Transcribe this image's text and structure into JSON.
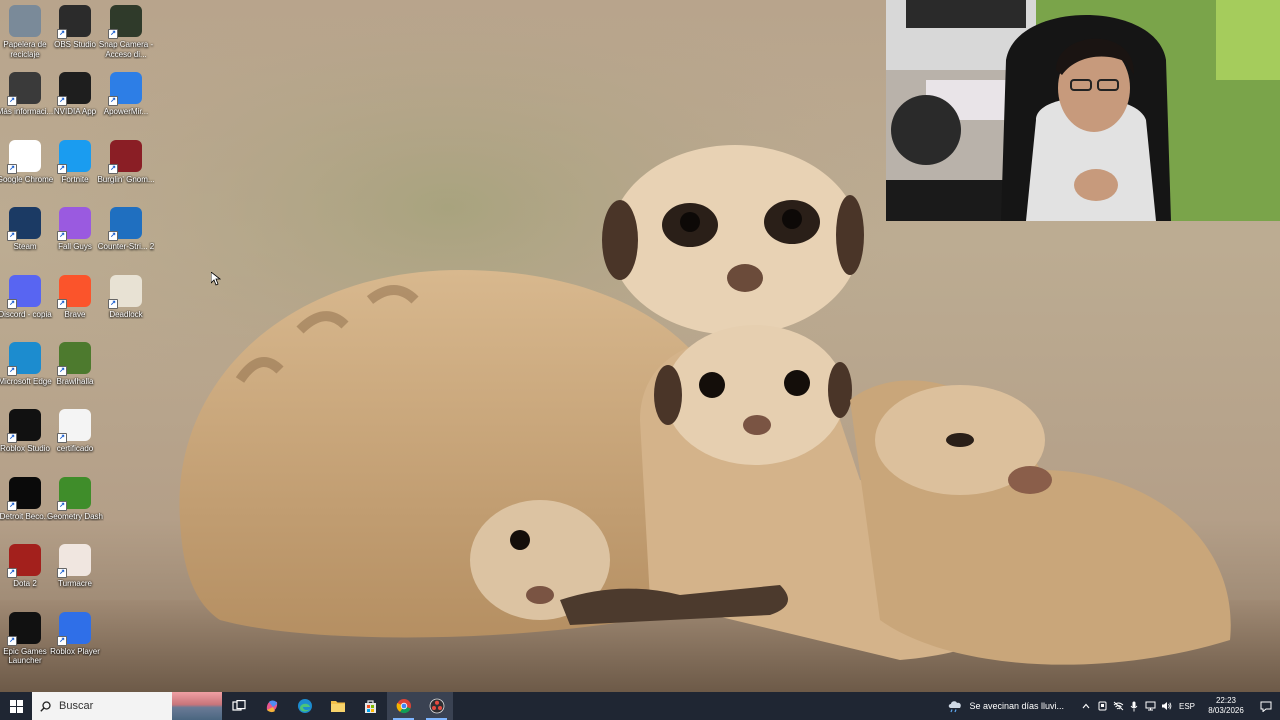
{
  "desktop": {
    "icons": [
      {
        "label": "Papelera de reciclaje",
        "icon": "recycle-bin-icon",
        "color": "#7a8a99"
      },
      {
        "label": "OBS Studio",
        "icon": "obs-icon",
        "color": "#2b2b2b"
      },
      {
        "label": "Snap Camera - Acceso di...",
        "icon": "snap-camera-icon",
        "color": "#2f3a2a"
      },
      {
        "label": "Más informaci...",
        "icon": "info-icon",
        "color": "#3a3a3a"
      },
      {
        "label": "NVIDIA App",
        "icon": "nvidia-icon",
        "color": "#1e1e1e"
      },
      {
        "label": "ApowerMir...",
        "icon": "apowermirror-icon",
        "color": "#2d7ee6"
      },
      {
        "label": "Google Chrome",
        "icon": "chrome-icon",
        "color": "#ffffff"
      },
      {
        "label": "Fortnite",
        "icon": "fortnite-icon",
        "color": "#1a9cf0"
      },
      {
        "label": "Burglin' Gnom...",
        "icon": "burglin-gnomes-icon",
        "color": "#8a1e25"
      },
      {
        "label": "Steam",
        "icon": "steam-icon",
        "color": "#1b3a64"
      },
      {
        "label": "Fall Guys",
        "icon": "fall-guys-icon",
        "color": "#9a5ae0"
      },
      {
        "label": "Counter-Stri... 2",
        "icon": "counter-strike-icon",
        "color": "#1f6fc0"
      },
      {
        "label": "Discord - copia",
        "icon": "discord-icon",
        "color": "#5865f2"
      },
      {
        "label": "Brave",
        "icon": "brave-icon",
        "color": "#fb542b"
      },
      {
        "label": "Deadlock",
        "icon": "deadlock-icon",
        "color": "#e8e2d4"
      },
      {
        "label": "Microsoft Edge",
        "icon": "edge-icon",
        "color": "#1c8ccf"
      },
      {
        "label": "Brawlhalla",
        "icon": "brawlhalla-icon",
        "color": "#4d7a2e"
      },
      {
        "label": "Roblox Studio",
        "icon": "roblox-studio-icon",
        "color": "#111111"
      },
      {
        "label": "certificado",
        "icon": "document-icon",
        "color": "#f4f4f4"
      },
      {
        "label": "Detroit Beco...",
        "icon": "detroit-icon",
        "color": "#0a0a0a"
      },
      {
        "label": "Geometry Dash",
        "icon": "geometry-dash-icon",
        "color": "#3f8d2a"
      },
      {
        "label": "Dota 2",
        "icon": "dota2-icon",
        "color": "#a3201c"
      },
      {
        "label": "Turmacre",
        "icon": "turmacre-icon",
        "color": "#f0e6e0"
      },
      {
        "label": "Epic Games Launcher",
        "icon": "epic-games-icon",
        "color": "#111111"
      },
      {
        "label": "Roblox Player",
        "icon": "roblox-icon",
        "color": "#2f6fe8"
      }
    ]
  },
  "taskbar": {
    "search_placeholder": "Buscar",
    "apps": [
      {
        "name": "task-view-icon",
        "active": false
      },
      {
        "name": "copilot-icon",
        "active": false
      },
      {
        "name": "edge-icon",
        "active": false
      },
      {
        "name": "file-explorer-icon",
        "active": false
      },
      {
        "name": "microsoft-store-icon",
        "active": false
      },
      {
        "name": "chrome-icon",
        "active": true
      },
      {
        "name": "obs-icon",
        "active": true
      }
    ],
    "weather_text": "Se avecinan días lluvi...",
    "language": "ESP",
    "time": "22:23",
    "date": "8/03/2026",
    "accent": "#7fb6ff"
  }
}
